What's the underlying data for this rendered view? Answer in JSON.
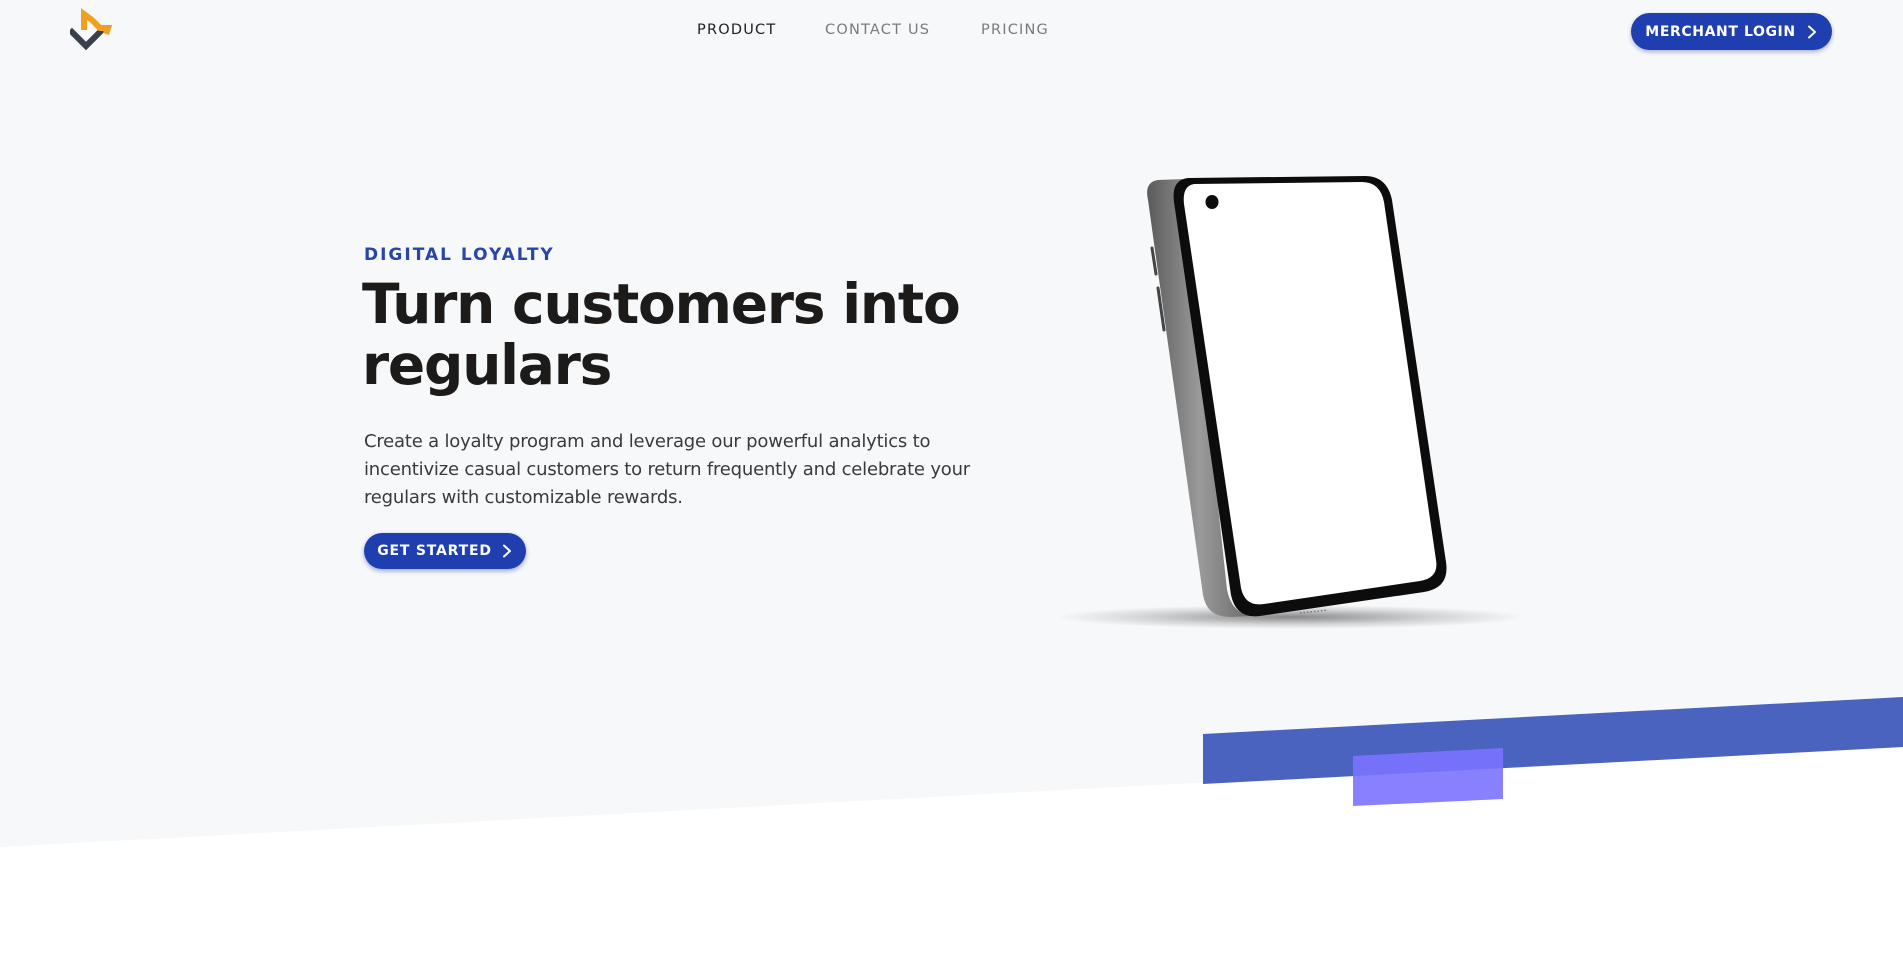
{
  "header": {
    "logo_icon": "brand-logo-icon",
    "nav": [
      {
        "label": "PRODUCT",
        "active": true
      },
      {
        "label": "CONTACT US",
        "active": false
      },
      {
        "label": "PRICING",
        "active": false
      }
    ],
    "merchant_login_label": "MERCHANT LOGIN"
  },
  "hero": {
    "eyebrow": "DIGITAL LOYALTY",
    "headline": "Turn customers into regulars",
    "description": "Create a loyalty program and leverage our powerful analytics to incentivize casual customers to return frequently and celebrate your regulars with customizable rewards.",
    "cta_label": "GET STARTED"
  },
  "colors": {
    "brand_blue": "#1f3fb0",
    "eyebrow_blue": "#2a45a8",
    "logo_orange": "#f0a020",
    "logo_dark": "#3a3f4d",
    "background": "#f7f8fa",
    "band_blue": "#4a63bf",
    "band_violet": "#8278ff"
  },
  "icons": {
    "chevron": "chevron-right-icon",
    "device": "smartphone-illustration"
  }
}
